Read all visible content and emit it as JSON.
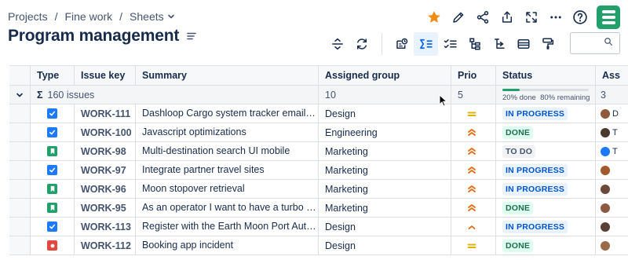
{
  "breadcrumb": {
    "items": [
      "Projects",
      "Fine work",
      "Sheets"
    ],
    "separator": "/"
  },
  "page": {
    "title": "Program management"
  },
  "icons": {
    "star": "star-icon",
    "edit": "pencil-icon",
    "share": "share-icon",
    "export": "export-icon",
    "fullscreen": "fullscreen-icon",
    "more": "more-icon",
    "help": "help-icon",
    "app_logo": "app-logo-icon",
    "title_menu": "menu-icon"
  },
  "toolbar": {
    "buttons": [
      "row-height-icon",
      "refresh-icon",
      "add-view-icon",
      "sum-icon",
      "checklist-icon",
      "hierarchy-icon",
      "tree-icon",
      "group-icon",
      "format-painter-icon",
      "search-icon"
    ],
    "active": "sum-icon"
  },
  "search": {
    "placeholder": ""
  },
  "grid": {
    "columns": [
      "Type",
      "Issue key",
      "Summary",
      "Assigned group",
      "Prio",
      "Status",
      "Ass"
    ],
    "summary": {
      "issues": "160 issues",
      "assigned_group": "10",
      "prio": "5",
      "status_done_fraction": 0.2,
      "status_done": "20% done",
      "status_remaining": "80% remaining",
      "assignee": "3"
    },
    "rows": [
      {
        "type": "task",
        "key": "WORK-111",
        "summary": "Dashloop Cargo system tracker email s...",
        "group": "Design",
        "prio": "medium",
        "status": "IN PROGRESS",
        "assignee": "D"
      },
      {
        "type": "task",
        "key": "WORK-100",
        "summary": "Javascript optimizations",
        "group": "Engineering",
        "prio": "high",
        "status": "DONE",
        "assignee": "T"
      },
      {
        "type": "story",
        "key": "WORK-98",
        "summary": "Multi-destination search UI mobile",
        "group": "Marketing",
        "prio": "high",
        "status": "TO DO",
        "assignee": "T"
      },
      {
        "type": "task",
        "key": "WORK-97",
        "summary": "Integrate partner travel sites",
        "group": "Marketing",
        "prio": "high",
        "status": "IN PROGRESS",
        "assignee": ""
      },
      {
        "type": "story",
        "key": "WORK-96",
        "summary": "Moon stopover retrieval",
        "group": "Marketing",
        "prio": "high",
        "status": "IN PROGRESS",
        "assignee": ""
      },
      {
        "type": "story",
        "key": "WORK-95",
        "summary": "As an operator I want to have a turbo b...",
        "group": "Marketing",
        "prio": "high",
        "status": "DONE",
        "assignee": ""
      },
      {
        "type": "task",
        "key": "WORK-113",
        "summary": "Register with the Earth Moon Port Auth...",
        "group": "Design",
        "prio": "low-high",
        "status": "IN PROGRESS",
        "assignee": ""
      },
      {
        "type": "bug",
        "key": "WORK-112",
        "summary": "Booking app incident",
        "group": "Design",
        "prio": "medium",
        "status": "DONE",
        "assignee": ""
      }
    ]
  },
  "colors": {
    "star": "#f18d13",
    "logo": "#22a06b",
    "task": "#1d7afc",
    "story": "#22a06b",
    "bug": "#e2483d",
    "prio_high": "#e56910",
    "prio_medium": "#e2b203",
    "status_blue": "#0055cc",
    "status_green": "#216e4e"
  }
}
